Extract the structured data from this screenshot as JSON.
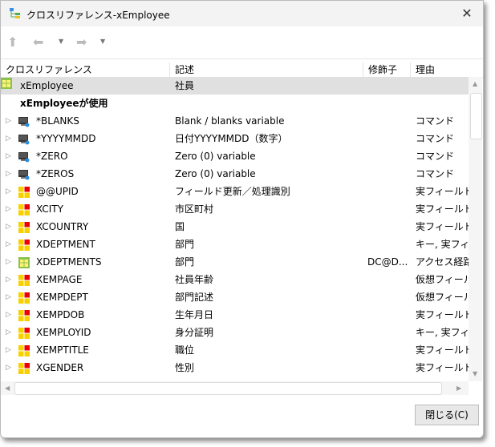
{
  "window": {
    "title": "クロスリファレンス-xEmployee",
    "close_icon": "close-icon"
  },
  "toolbar": {
    "up": "up-arrow-icon",
    "back": "back-arrow-icon",
    "forward": "forward-arrow-icon"
  },
  "columns": [
    "クロスリファレンス",
    "記述",
    "修飾子",
    "理由"
  ],
  "root": {
    "name": "xEmployee",
    "description": "社員"
  },
  "group_heading": "xEmployeeが使用",
  "rows": [
    {
      "icon": "monitor",
      "name": "*BLANKS",
      "description": "Blank / blanks variable",
      "modifier": "",
      "reason": "コマンド"
    },
    {
      "icon": "monitor",
      "name": "*YYYYMMDD",
      "description": "日付YYYYMMDD（数字）",
      "modifier": "",
      "reason": "コマンド"
    },
    {
      "icon": "monitor",
      "name": "*ZERO",
      "description": "Zero (0) variable",
      "modifier": "",
      "reason": "コマンド"
    },
    {
      "icon": "monitor",
      "name": "*ZEROS",
      "description": "Zero (0) variable",
      "modifier": "",
      "reason": "コマンド"
    },
    {
      "icon": "field",
      "name": "@@UPID",
      "description": "フィールド更新／処理識別",
      "modifier": "",
      "reason": "実フィールド"
    },
    {
      "icon": "field",
      "name": "XCITY",
      "description": "市区町村",
      "modifier": "",
      "reason": "実フィールド,..."
    },
    {
      "icon": "field",
      "name": "XCOUNTRY",
      "description": "国",
      "modifier": "",
      "reason": "実フィールド,..."
    },
    {
      "icon": "field",
      "name": "XDEPTMENT",
      "description": "部門",
      "modifier": "",
      "reason": "キー, 実フィール"
    },
    {
      "icon": "table",
      "name": "XDEPTMENTS",
      "description": "部門",
      "modifier": "DC@D...",
      "reason": "アクセス経路,..."
    },
    {
      "icon": "field",
      "name": "XEMPAGE",
      "description": "社員年齢",
      "modifier": "",
      "reason": "仮想フィールド,"
    },
    {
      "icon": "field",
      "name": "XEMPDEPT",
      "description": "部門記述",
      "modifier": "",
      "reason": "仮想フィールド,"
    },
    {
      "icon": "field",
      "name": "XEMPDOB",
      "description": "生年月日",
      "modifier": "",
      "reason": "実フィールド,..."
    },
    {
      "icon": "field",
      "name": "XEMPLOYID",
      "description": "身分証明",
      "modifier": "",
      "reason": "キー, 実フィール"
    },
    {
      "icon": "field",
      "name": "XEMPTITLE",
      "description": "職位",
      "modifier": "",
      "reason": "実フィールド,..."
    },
    {
      "icon": "field",
      "name": "XGENDER",
      "description": "性別",
      "modifier": "",
      "reason": "実フィールド,..."
    }
  ],
  "footer": {
    "close_label": "閉じる(C)"
  }
}
